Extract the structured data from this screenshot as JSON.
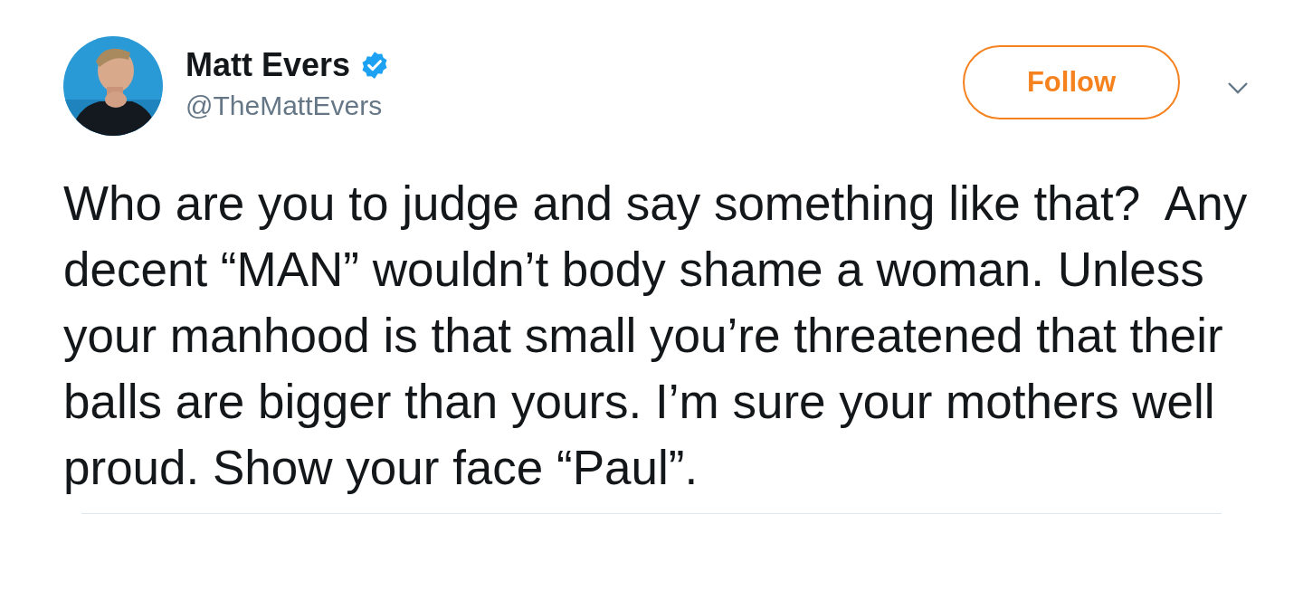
{
  "author": {
    "name": "Matt Evers",
    "verified": true,
    "handle": "@TheMattEvers"
  },
  "follow_button": {
    "label": "Follow"
  },
  "tweet": {
    "text": "Who are you to judge and say something like that?  Any decent “MAN” wouldn’t body shame a woman. Unless your manhood is that small you’re threatened that their balls are bigger than yours. I’m sure your mothers well proud. Show your face “Paul”."
  }
}
